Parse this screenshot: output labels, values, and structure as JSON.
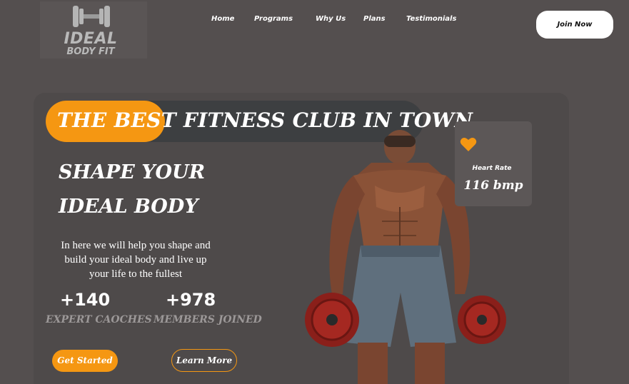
{
  "brand": {
    "line1": "IDEAL",
    "line2": "BODY FIT",
    "icon": "dumbbell-icon"
  },
  "nav": {
    "items": [
      "Home",
      "Programs",
      "Why Us",
      "Plans",
      "Testimonials"
    ],
    "cta": "Join Now"
  },
  "hero": {
    "badge_highlight": "THE BEST",
    "badge_rest": " FITNESS CLUB IN TOWN",
    "headline_line1": "SHAPE YOUR",
    "headline_line2": "IDEAL BODY",
    "description": "In here we will help you shape and build your ideal body  and live  up your  life to the fullest",
    "stats": [
      {
        "value": "+140",
        "label": "EXPERT CAOCHES"
      },
      {
        "value": "+978",
        "label": "MEMBERS JOINED"
      }
    ],
    "primary_button": "Get Started",
    "secondary_button": "Learn More"
  },
  "heart_rate": {
    "label": "Heart Rate",
    "value": "116 bmp",
    "icon": "heart-icon"
  },
  "colors": {
    "accent": "#f59712",
    "background": "#544f4f",
    "card": "#4e4a4a",
    "badge": "#3d3f41"
  }
}
